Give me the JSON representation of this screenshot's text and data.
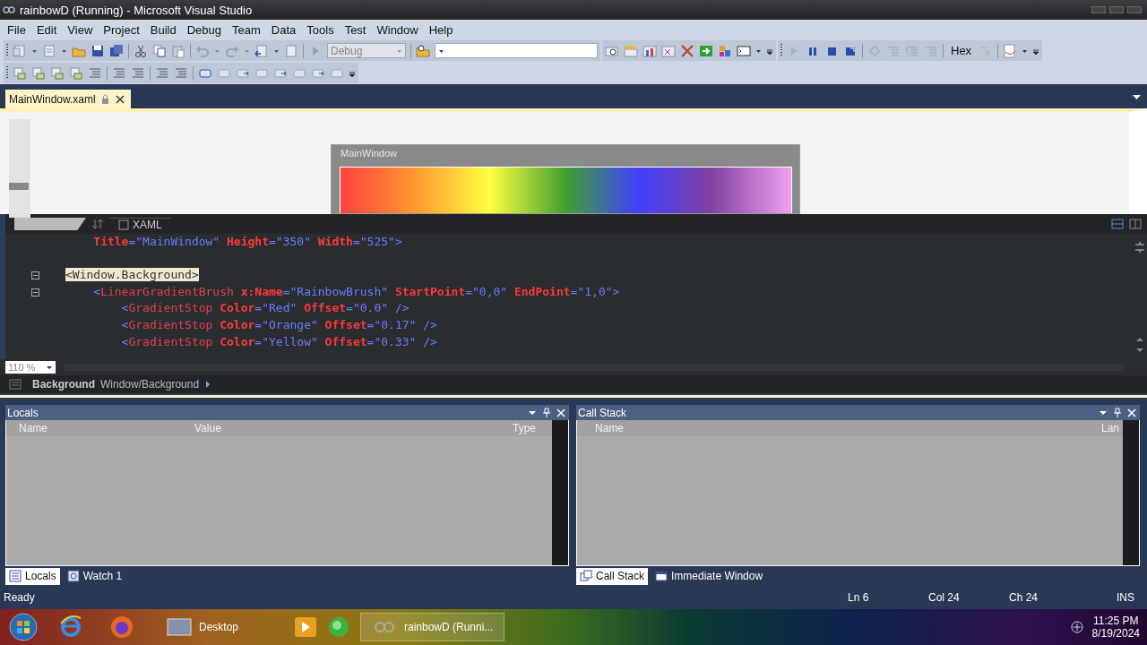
{
  "window": {
    "title": "rainbowD (Running) - Microsoft Visual Studio"
  },
  "menu": [
    "File",
    "Edit",
    "View",
    "Project",
    "Build",
    "Debug",
    "Team",
    "Data",
    "Tools",
    "Test",
    "Window",
    "Help"
  ],
  "toolbar": {
    "configuration": "Debug",
    "hex_label": "Hex"
  },
  "document_tabs": [
    {
      "label": "MainWindow.xaml",
      "selected": true,
      "locked": true
    }
  ],
  "designer": {
    "zoom_slider": {
      "level": 0.3
    },
    "preview_title": "MainWindow"
  },
  "editor": {
    "view_tab": "XAML",
    "zoom": "110 %",
    "lines": [
      {
        "tokens": [
          {
            "kind": "attr",
            "t": "    Title"
          },
          {
            "kind": "value",
            "t": "=\"MainWindow\""
          },
          {
            "kind": "attr",
            "t": " Height"
          },
          {
            "kind": "value",
            "t": "=\"350\""
          },
          {
            "kind": "attr",
            "t": " Width"
          },
          {
            "kind": "value",
            "t": "=\"525\">"
          }
        ]
      },
      {
        "blank_before": true,
        "outline": true,
        "tokens": [
          {
            "kind": "selected",
            "t": "<Window.Background>"
          }
        ]
      },
      {
        "outline": true,
        "tokens": [
          {
            "kind": "value",
            "t": "    <"
          },
          {
            "kind": "tag",
            "t": "LinearGradientBrush"
          },
          {
            "kind": "attr",
            "t": " x:Name"
          },
          {
            "kind": "value",
            "t": "=\"RainbowBrush\""
          },
          {
            "kind": "attr",
            "t": " StartPoint"
          },
          {
            "kind": "value",
            "t": "=\"0,0\""
          },
          {
            "kind": "attr",
            "t": " EndPoint"
          },
          {
            "kind": "value",
            "t": "=\"1,0\">"
          }
        ]
      },
      {
        "tokens": [
          {
            "kind": "value",
            "t": "        <"
          },
          {
            "kind": "tag",
            "t": "GradientStop"
          },
          {
            "kind": "attr",
            "t": " Color"
          },
          {
            "kind": "value",
            "t": "=\"Red\""
          },
          {
            "kind": "attr",
            "t": " Offset"
          },
          {
            "kind": "value",
            "t": "=\"0.0\" />"
          }
        ]
      },
      {
        "tokens": [
          {
            "kind": "value",
            "t": "        <"
          },
          {
            "kind": "tag",
            "t": "GradientStop"
          },
          {
            "kind": "attr",
            "t": " Color"
          },
          {
            "kind": "value",
            "t": "=\"Orange\""
          },
          {
            "kind": "attr",
            "t": " Offset"
          },
          {
            "kind": "value",
            "t": "=\"0.17\" />"
          }
        ]
      },
      {
        "tokens": [
          {
            "kind": "value",
            "t": "        <"
          },
          {
            "kind": "tag",
            "t": "GradientStop"
          },
          {
            "kind": "attr",
            "t": " Color"
          },
          {
            "kind": "value",
            "t": "=\"Yellow\""
          },
          {
            "kind": "attr",
            "t": " Offset"
          },
          {
            "kind": "value",
            "t": "=\"0.33\" />"
          }
        ]
      }
    ]
  },
  "breadcrumb": {
    "element": "Background",
    "path": "Window/Background"
  },
  "panels": [
    {
      "title": "Locals",
      "columns": [
        "Name",
        "Value",
        "Type"
      ],
      "tabs": [
        {
          "label": "Locals",
          "selected": true
        },
        {
          "label": "Watch 1",
          "selected": false
        }
      ]
    },
    {
      "title": "Call Stack",
      "columns": [
        "Name",
        "Lan"
      ],
      "tabs": [
        {
          "label": "Call Stack",
          "selected": true
        },
        {
          "label": "Immediate Window",
          "selected": false
        }
      ]
    }
  ],
  "status_bar": {
    "message": "Ready",
    "line": "Ln 6",
    "column": "Col 24",
    "char": "Ch 24",
    "mode": "INS"
  },
  "taskbar": {
    "items": [
      {
        "kind": "button",
        "label": "Desktop",
        "active": false
      },
      {
        "kind": "button",
        "label": "rainbowD (Runni...",
        "active": true
      }
    ],
    "time": "11:25 PM",
    "date": "8/19/2024"
  }
}
